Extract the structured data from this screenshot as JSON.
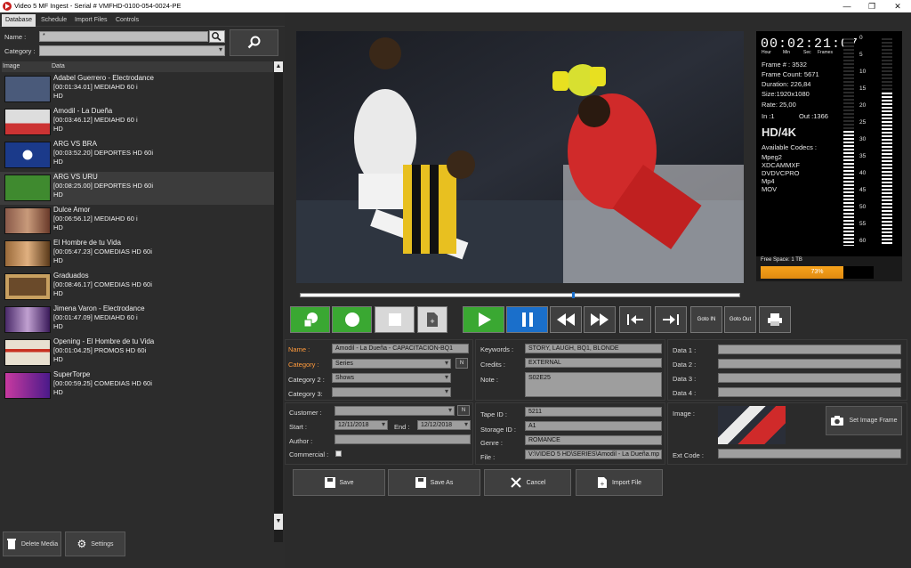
{
  "window": {
    "title": "Video 5 MF Ingest - Serial # VMFHD-0100-054-0024-PE",
    "minimize": "—",
    "maximize": "❐",
    "close": "✕"
  },
  "tabs": [
    {
      "label": "Database"
    },
    {
      "label": "Schedule"
    },
    {
      "label": "Import Files"
    },
    {
      "label": "Controls"
    }
  ],
  "search": {
    "name_label": "Name :",
    "name_value": "*",
    "category_label": "Category :",
    "category_value": ""
  },
  "list": {
    "col_image": "Image",
    "col_data": "Data",
    "items": [
      {
        "title": "Adabel Guerrero - Electrodance",
        "info": "[00:01:34.01]  MEDIAHD 60 i",
        "hd": "HD",
        "thumb_color": "#4a5a7a"
      },
      {
        "title": "Amodil - La Dueña",
        "info": "[00:03:46.12]  MEDIAHD 60 i",
        "hd": "HD",
        "thumb_color": "#c8c8c8"
      },
      {
        "title": "ARG VS BRA",
        "info": "[00:03:52.20]  DEPORTES HD 60i",
        "hd": "HD",
        "thumb_color": "#1b3a8a"
      },
      {
        "title": "ARG VS URU",
        "info": "[00:08:25.00]  DEPORTES HD 60i",
        "hd": "HD",
        "thumb_color": "#3f8a2f"
      },
      {
        "title": "Dulce Amor",
        "info": "[00:06:56.12]  MEDIAHD 60 i",
        "hd": "HD",
        "thumb_color": "#8a5a4a"
      },
      {
        "title": "El Hombre de tu Vida",
        "info": "[00:05:47.23]  COMEDIAS HD 60i",
        "hd": "HD",
        "thumb_color": "#9a6a3a"
      },
      {
        "title": "Graduados",
        "info": "[00:08:46.17]  COMEDIAS HD 60i",
        "hd": "HD",
        "thumb_color": "#6a4a2a"
      },
      {
        "title": "Jimena Varon - Electrodance",
        "info": "[00:01:47.09]  MEDIAHD 60 i",
        "hd": "HD",
        "thumb_color": "#4a2a6a"
      },
      {
        "title": "Opening - El Hombre de tu Vida",
        "info": "[00:01:04.25]  PROMOS HD 60i",
        "hd": "HD",
        "thumb_color": "#e8e0d0"
      },
      {
        "title": "SuperTorpe",
        "info": "[00:00:59.25]  COMEDIAS HD 60i",
        "hd": "HD",
        "thumb_color": "#c83aa0"
      }
    ]
  },
  "bottom_left": {
    "delete_label": "Delete Media",
    "settings_label": "Settings"
  },
  "info_panel": {
    "timecode": "00:02:21:07",
    "tc_units": [
      "Hour",
      "Min",
      "Sec",
      "Frames"
    ],
    "frame_num": "Frame # : 3532",
    "frame_count": "Frame Count: 5671",
    "duration": "Duration: 226,84",
    "size": "Size:1920x1080",
    "rate": "Rate: 25,00",
    "in_point": "In :1",
    "out_point": "Out :1366",
    "format": "HD/4K",
    "codecs_label": "Available Codecs :",
    "codecs": [
      "Mpeg2",
      "XDCAMMXF",
      "DVDVCPRO",
      "Mp4",
      "MOV"
    ],
    "meter_ticks": [
      "0",
      "5",
      "10",
      "15",
      "20",
      "25",
      "30",
      "35",
      "40",
      "45",
      "50",
      "55",
      "60"
    ],
    "meter_left_level": 0.55,
    "meter_right_level": 0.73,
    "free_space": "Free Space:  1 TB",
    "free_percent": "73%",
    "free_fraction": 0.73
  },
  "timeline": {
    "position": 0.62
  },
  "controls": {
    "goto_in": "Goto IN",
    "goto_out": "Goto Out"
  },
  "form": {
    "name_label": "Name :",
    "name_value": "Amodil - La Dueña - CAPACITACION-BQ1",
    "category_label": "Category :",
    "category_value": "Series",
    "category2_label": "Category 2 :",
    "category2_value": "Shows",
    "category3_label": "Category 3:",
    "category3_value": "",
    "n_label": "N",
    "keywords_label": "Keywords :",
    "keywords_value": "STORY, LAUGH, BQ1,  BLONDE",
    "credits_label": "Credits :",
    "credits_value": "EXTERNAL",
    "note_label": "Note :",
    "note_value": "S02E25",
    "data1_label": "Data 1 :",
    "data2_label": "Data 2 :",
    "data3_label": "Data 3 :",
    "data4_label": "Data 4 :",
    "customer_label": "Customer :",
    "start_label": "Start :",
    "start_value": "12/11/2018",
    "end_label": "End :",
    "end_value": "12/12/2018",
    "author_label": "Author :",
    "commercial_label": "Commercial :",
    "tape_label": "Tape ID :",
    "tape_value": "5211",
    "storage_label": "Storage ID :",
    "storage_value": "A1",
    "genre_label": "Genre :",
    "genre_value": "ROMANCE",
    "file_label": "File :",
    "file_value": "V:\\VIDEO 5 HD\\SERIES\\Amodil - La Dueña.mp",
    "image_label": "Image :",
    "set_frame_label": "Set Image Frame",
    "extcode_label": "Ext Code :"
  },
  "actions": {
    "save": "Save",
    "save_as": "Save As",
    "cancel": "Cancel",
    "import": "Import File"
  },
  "colors": {
    "green": "#3aa832",
    "blue": "#1a6fcb",
    "orange_label": "#ff9a3c",
    "free_bar": "#f7a21b"
  }
}
